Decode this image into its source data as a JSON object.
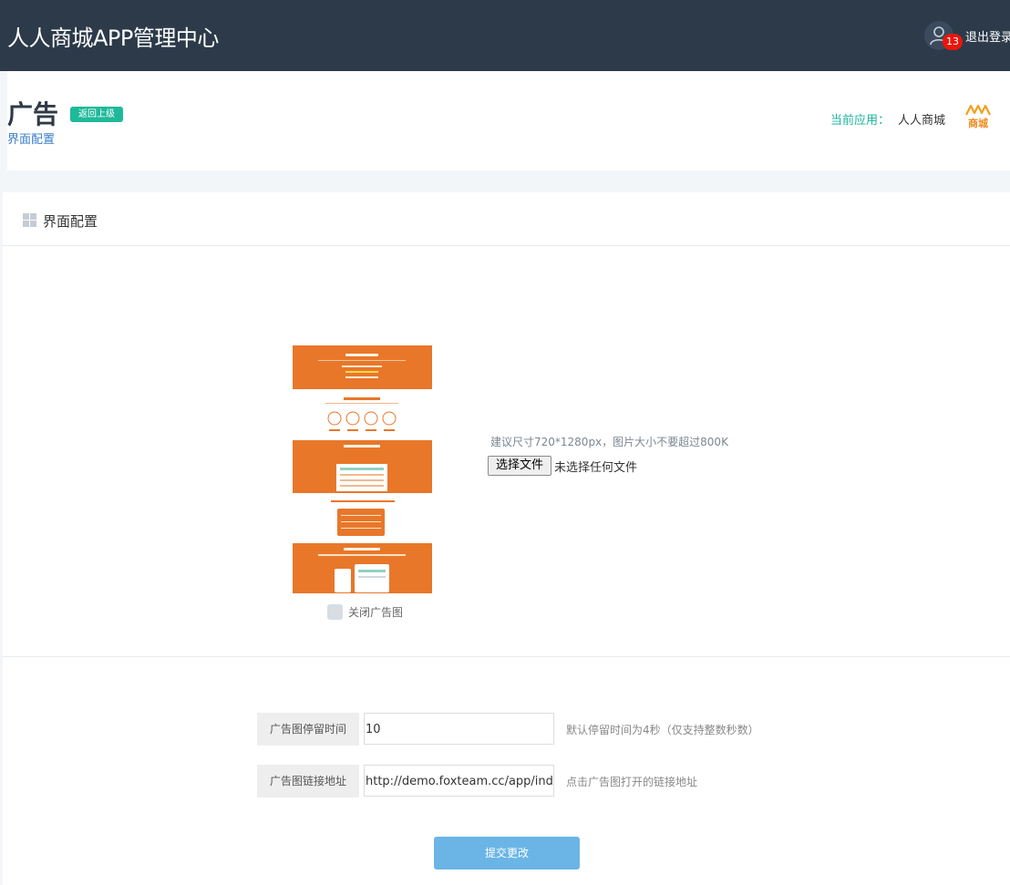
{
  "header": {
    "app_title": "人人商城APP管理中心",
    "notification_count": "13",
    "logout_label": "退出登录"
  },
  "page": {
    "title": "广告",
    "back_label": "返回上级",
    "subtitle": "界面配置",
    "current_app_label": "当前应用：",
    "current_app_name": "人人商城",
    "logo_text": "商城"
  },
  "section": {
    "title": "界面配置"
  },
  "ad_image": {
    "size_hint": "建议尺寸720*1280px，图片大小不要超过800K",
    "choose_file_label": "选择文件",
    "file_status": "未选择任何文件",
    "close_checkbox_label": "关闭广告图",
    "close_checked": false
  },
  "form": {
    "fields": [
      {
        "label": "广告图停留时间",
        "value": "10",
        "note": "默认停留时间为4秒（仅支持整数秒数）"
      },
      {
        "label": "广告图链接地址",
        "value": "http://demo.foxteam.cc/app/index.php",
        "note": "点击广告图打开的链接地址"
      }
    ],
    "submit_label": "提交更改"
  },
  "colors": {
    "topbar": "#2c3a4a",
    "accent_green": "#1fb99a",
    "link_blue": "#3a7dc9",
    "preview_orange": "#e8772a",
    "submit_blue": "#6ab5e6",
    "badge_red": "#e8160b"
  }
}
